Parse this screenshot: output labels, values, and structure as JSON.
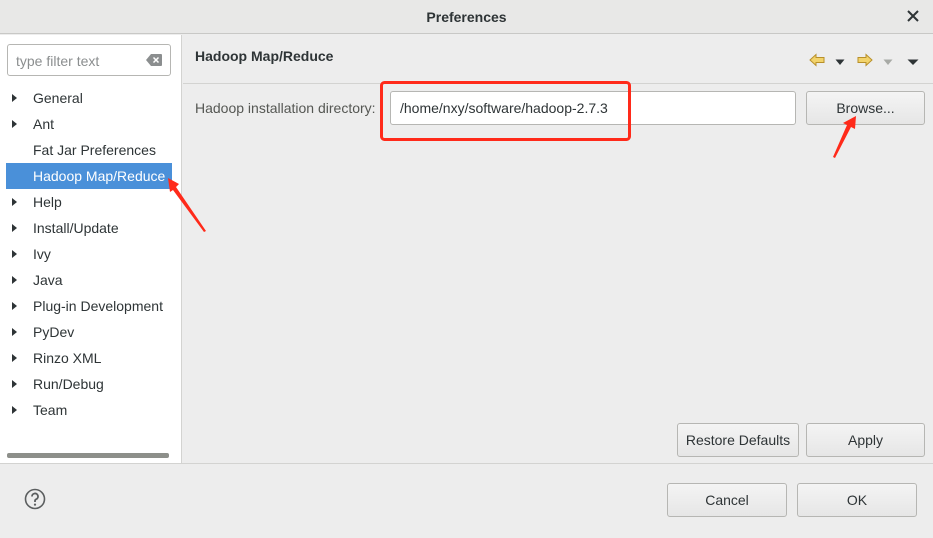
{
  "window": {
    "title": "Preferences"
  },
  "filter": {
    "placeholder": "type filter text"
  },
  "tree": {
    "items": [
      {
        "label": "General",
        "expandable": true
      },
      {
        "label": "Ant",
        "expandable": true
      },
      {
        "label": "Fat Jar Preferences",
        "expandable": false
      },
      {
        "label": "Hadoop Map/Reduce",
        "expandable": false,
        "selected": true
      },
      {
        "label": "Help",
        "expandable": true
      },
      {
        "label": "Install/Update",
        "expandable": true
      },
      {
        "label": "Ivy",
        "expandable": true
      },
      {
        "label": "Java",
        "expandable": true
      },
      {
        "label": "Plug-in Development",
        "expandable": true
      },
      {
        "label": "PyDev",
        "expandable": true
      },
      {
        "label": "Rinzo XML",
        "expandable": true
      },
      {
        "label": "Run/Debug",
        "expandable": true
      },
      {
        "label": "Team",
        "expandable": true
      }
    ]
  },
  "page": {
    "title": "Hadoop Map/Reduce",
    "dir_label": "Hadoop installation directory:",
    "dir_value": "/home/nxy/software/hadoop-2.7.3",
    "browse_label": "Browse...",
    "restore_label": "Restore Defaults",
    "apply_label": "Apply"
  },
  "footer": {
    "cancel_label": "Cancel",
    "ok_label": "OK"
  },
  "icons": {
    "close": "close-icon",
    "clear": "clear-filter-icon",
    "back": "back-arrow-icon",
    "forward": "forward-arrow-icon",
    "menu": "view-menu-icon",
    "help": "help-icon"
  },
  "colors": {
    "selection": "#4a90d9",
    "annotation": "#ff2a1a",
    "nav_arrow": "#e0b84a"
  }
}
